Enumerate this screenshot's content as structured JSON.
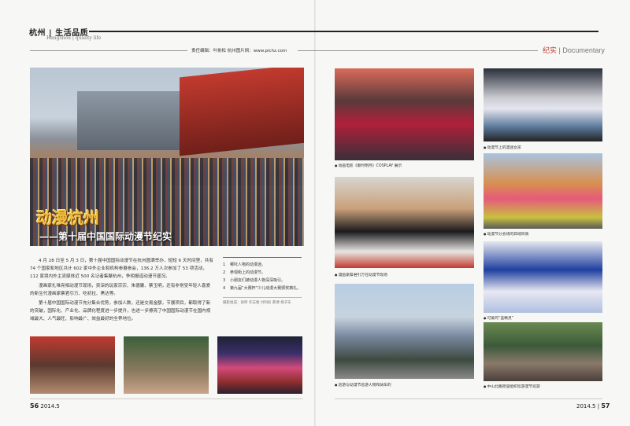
{
  "header": {
    "title": "杭州 | 生活品质",
    "subtitle": "Hangzhou | quality life",
    "credit": "责任编辑：叶彬松    杭州图片网：www.pichz.com",
    "section_cn": "纪实",
    "section_sep": " | ",
    "section_en": "Documentary"
  },
  "hero": {
    "title": "动漫杭州",
    "subtitle": "——第十届中国国际动漫节纪实"
  },
  "article": {
    "paragraphs": [
      "4 月 28 日至 5 月 3 日，第十届中国国际动漫节在杭州圆满举办，短短 6 天时间里，共有 74 个国家和地区共计 602 家中外企业和机构参展参会，136.2 万人次参加了 53 项活动，112 家境内外主流媒体近 500 名记者集聚杭州，争相报道动漫节盛况。",
      "漫画家扎堆亮相动漫节现场，资深的玩家宗宗、朱德庸、蔡玉明，还有非常受年轻人喜爱的新生代漫画家蔡君引万、吃初拉、黑达等。",
      "第十届中国国际动漫节充分集合优势，参加人数，还是交易金额，节展项目，都取得了新的突破，国际化、产业化、品牌化程度进一步提升，也进一步擦亮了中国国际动漫节在国内视域最大、人气最旺、影响最广、效益最好的全界地位。"
    ]
  },
  "sidebar": {
    "items": [
      {
        "num": "1",
        "text": "哪吒人物的动漫迷。"
      },
      {
        "num": "2",
        "text": "参观街上的动漫节。"
      },
      {
        "num": "3",
        "text": "小朋友们被动漫人物深深吸引。"
      },
      {
        "num": "4",
        "text": "第九届“大赛杯”少儿动漫大赛颁奖典礼。"
      }
    ],
    "photo_credit": "摄影组成：张昕  许志春  付利民  黄博  杨子乐"
  },
  "captions": {
    "p1": "动画电影《秦时明月》COSPLAY 展示",
    "p2": "动漫节上的漫迷女孩",
    "p3": "漫画家蔡君引万在动漫节现场",
    "p4": "动漫节分会场的异域风情",
    "p5": "巡游与动漫节巡游人物和骑车的",
    "p6": "可爱的“蓝精灵”",
    "p7": "中山北路街道组织巡游漫节巡游"
  },
  "footer": {
    "left_page": "56",
    "left_date": "2014.5",
    "right_date": "2014.5",
    "right_page": "57"
  }
}
